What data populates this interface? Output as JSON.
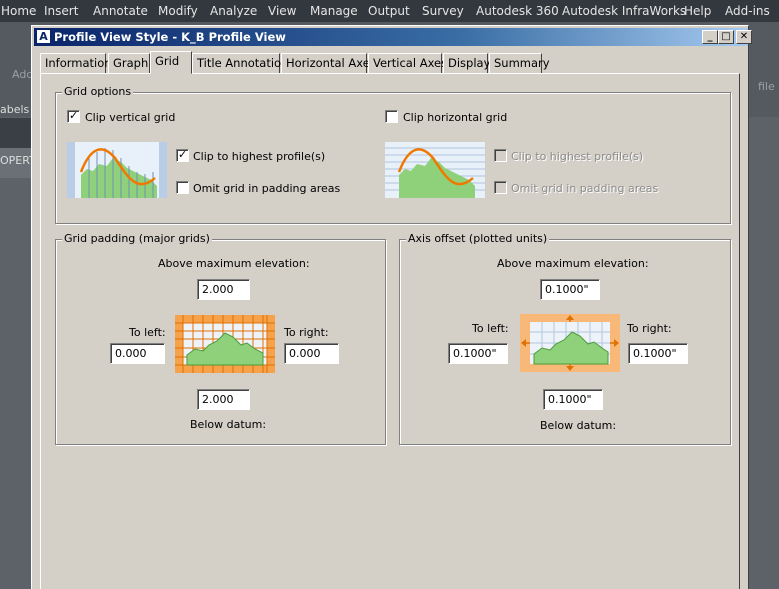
{
  "ribbon": {
    "tabs": [
      "Home",
      "Insert",
      "Annotate",
      "Modify",
      "Analyze",
      "View",
      "Manage",
      "Output",
      "Survey",
      "Autodesk 360",
      "Autodesk InfraWorks",
      "Help",
      "Add-ins"
    ]
  },
  "background": {
    "labels_text": "abels",
    "properties_text": "OPERT",
    "ad_text": "Add",
    "right_text": "file"
  },
  "dialog": {
    "title": "Profile View Style - K_B Profile View",
    "app_icon": "civil3d-icon",
    "controls": {
      "minimize": "_",
      "maximize": "□",
      "close": "✕"
    },
    "tabs": [
      {
        "label": "Information"
      },
      {
        "label": "Graph"
      },
      {
        "label": "Grid",
        "active": true
      },
      {
        "label": "Title Annotation"
      },
      {
        "label": "Horizontal Axes"
      },
      {
        "label": "Vertical Axes"
      },
      {
        "label": "Display"
      },
      {
        "label": "Summary"
      }
    ],
    "grid_options": {
      "title": "Grid options",
      "clip_vertical": {
        "label": "Clip vertical grid",
        "checked": true
      },
      "clip_highest_v": {
        "label": "Clip to highest profile(s)",
        "checked": true
      },
      "omit_padding_v": {
        "label": "Omit grid in padding areas",
        "checked": false
      },
      "clip_horizontal": {
        "label": "Clip horizontal grid",
        "checked": false
      },
      "clip_highest_h": {
        "label": "Clip to highest profile(s)",
        "checked": false,
        "disabled": true
      },
      "omit_padding_h": {
        "label": "Omit grid in padding areas",
        "checked": false,
        "disabled": true
      }
    },
    "grid_padding": {
      "title": "Grid padding (major grids)",
      "above_label": "Above maximum elevation:",
      "above_value": "2.000",
      "left_label": "To left:",
      "left_value": "0.000",
      "right_label": "To right:",
      "right_value": "0.000",
      "below_value": "2.000",
      "below_label": "Below datum:"
    },
    "axis_offset": {
      "title": "Axis offset (plotted units)",
      "above_label": "Above maximum elevation:",
      "above_value": "0.1000\"",
      "left_label": "To left:",
      "left_value": "0.1000\"",
      "right_label": "To right:",
      "right_value": "0.1000\"",
      "below_value": "0.1000\"",
      "below_label": "Below datum:"
    },
    "colors": {
      "profile_curve": "#f07800",
      "terrain_fill": "#8fd17a",
      "grid_lines": "#b0c4de",
      "padding_highlight": "#f5a24a"
    }
  }
}
